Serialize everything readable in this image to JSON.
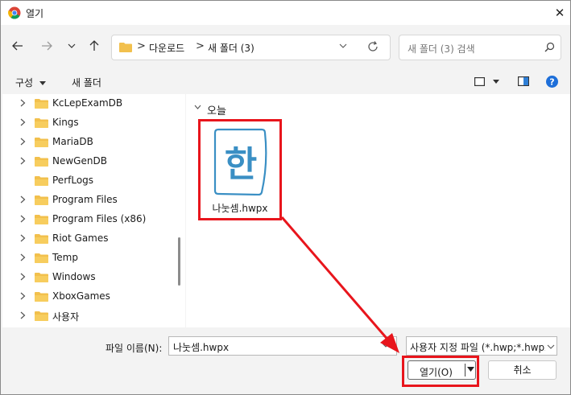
{
  "window": {
    "title": "열기",
    "close_icon": "close-icon"
  },
  "nav": {
    "back_icon": "arrow-left-icon",
    "forward_icon": "arrow-right-icon",
    "recent_icon": "chevron-down-icon",
    "up_icon": "arrow-up-icon"
  },
  "address": {
    "crumbs": [
      "다운로드",
      "새 폴더 (3)"
    ],
    "separator": ">"
  },
  "search": {
    "placeholder": "새 폴더 (3) 검색"
  },
  "toolbar": {
    "organize_label": "구성",
    "new_folder_label": "새 폴더"
  },
  "tree": {
    "items": [
      {
        "label": "KcLepExamDB",
        "expandable": true
      },
      {
        "label": "Kings",
        "expandable": true
      },
      {
        "label": "MariaDB",
        "expandable": true
      },
      {
        "label": "NewGenDB",
        "expandable": true
      },
      {
        "label": "PerfLogs",
        "expandable": false
      },
      {
        "label": "Program Files",
        "expandable": true
      },
      {
        "label": "Program Files (x86)",
        "expandable": true
      },
      {
        "label": "Riot Games",
        "expandable": true
      },
      {
        "label": "Temp",
        "expandable": true
      },
      {
        "label": "Windows",
        "expandable": true
      },
      {
        "label": "XboxGames",
        "expandable": true
      },
      {
        "label": "사용자",
        "expandable": true
      }
    ]
  },
  "content": {
    "group_label": "오늘",
    "file": {
      "name": "나눗셈.hwpx",
      "icon_glyph": "한"
    }
  },
  "bottom": {
    "filename_label": "파일 이름(N):",
    "filename_value": "나눗셈.hwpx",
    "filter_value": "사용자 지정 파일 (*.hwp;*.hwpx",
    "open_label": "열기(O)",
    "cancel_label": "취소"
  },
  "colors": {
    "highlight": "#e8151c",
    "folder": "#f2c04d",
    "help": "#1e6fd9",
    "hwp": "#3a8fc4"
  }
}
